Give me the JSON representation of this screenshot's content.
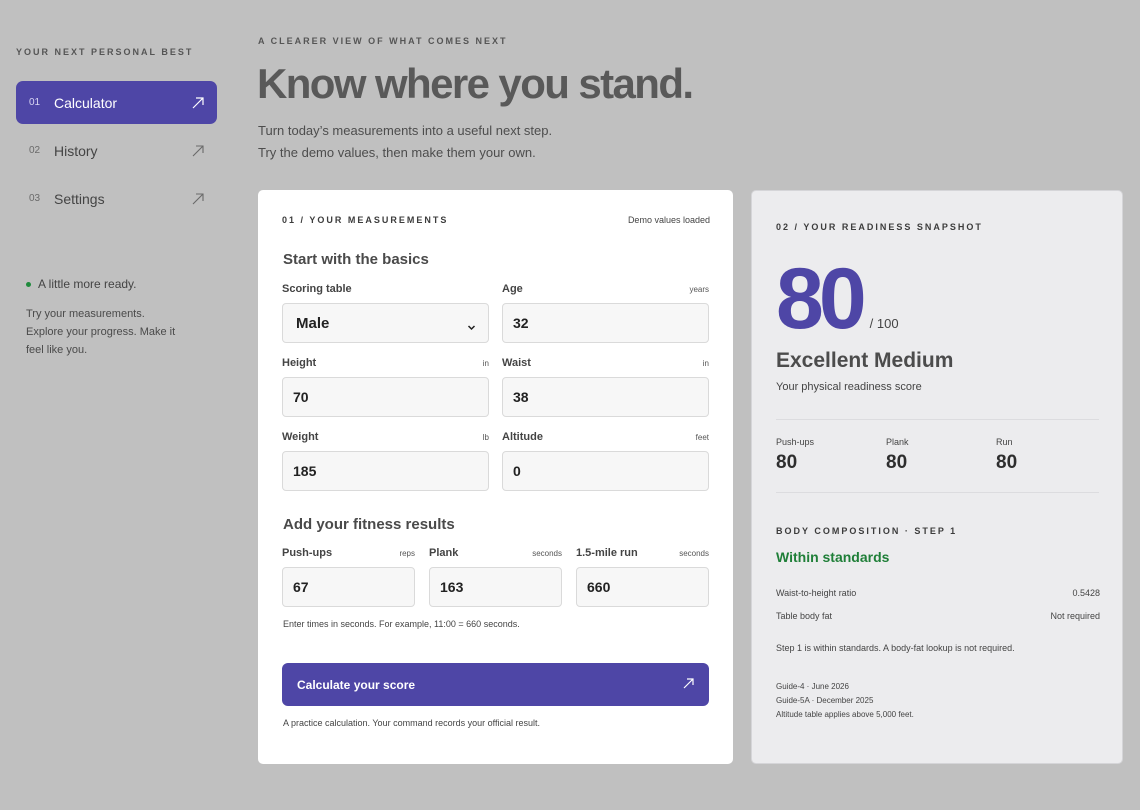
{
  "sidebar": {
    "brand": "YOUR NEXT PERSONAL BEST",
    "items": [
      {
        "num": "01",
        "label": "Calculator",
        "active": true
      },
      {
        "num": "02",
        "label": "History",
        "active": false
      },
      {
        "num": "03",
        "label": "Settings",
        "active": false
      }
    ],
    "status": {
      "line": "A little more ready.",
      "desc": "Try your measurements. Explore your progress. Make it feel like you."
    }
  },
  "header": {
    "eyebrow": "A CLEARER VIEW OF WHAT COMES NEXT",
    "title": "Know where you stand.",
    "intro_1": "Turn today’s measurements into a useful next step.",
    "intro_2": "Try the demo values, then make them your own."
  },
  "measurements": {
    "section_label": "01 / YOUR MEASUREMENTS",
    "demo_note": "Demo values loaded",
    "basics_title": "Start with the basics",
    "scoring_table": {
      "label": "Scoring table",
      "value": "Male"
    },
    "age": {
      "label": "Age",
      "unit": "years",
      "value": "32"
    },
    "height": {
      "label": "Height",
      "unit": "in",
      "value": "70"
    },
    "waist": {
      "label": "Waist",
      "unit": "in",
      "value": "38"
    },
    "weight": {
      "label": "Weight",
      "unit": "lb",
      "value": "185"
    },
    "altitude": {
      "label": "Altitude",
      "unit": "feet",
      "value": "0"
    },
    "fitness_title": "Add your fitness results",
    "pushups": {
      "label": "Push-ups",
      "unit": "reps",
      "value": "67"
    },
    "plank": {
      "label": "Plank",
      "unit": "seconds",
      "value": "163"
    },
    "run": {
      "label": "1.5-mile run",
      "unit": "seconds",
      "value": "660"
    },
    "hint": "Enter times in seconds. For example, 11:00 = 660 seconds.",
    "cta": "Calculate your score",
    "cta_note": "A practice calculation. Your command records your official result."
  },
  "snapshot": {
    "section_label": "02 / YOUR READINESS SNAPSHOT",
    "score": "80",
    "score_max": "/ 100",
    "rating": "Excellent Medium",
    "subtitle": "Your physical readiness score",
    "metrics": [
      {
        "label": "Push-ups",
        "value": "80"
      },
      {
        "label": "Plank",
        "value": "80"
      },
      {
        "label": "Run",
        "value": "80"
      }
    ],
    "body_comp": {
      "label": "BODY COMPOSITION · STEP 1",
      "status": "Within standards",
      "status_color": "#1f7f38",
      "rows": [
        {
          "key": "Waist-to-height ratio",
          "value": "0.5428"
        },
        {
          "key": "Table body fat",
          "value": "Not required"
        }
      ],
      "note": "Step 1 is within standards. A body-fat lookup is not required."
    },
    "references": [
      "Guide-4 · June 2026",
      "Guide-5A · December 2025",
      "Altitude table applies above 5,000 feet."
    ]
  },
  "colors": {
    "accent": "#4e46a6",
    "background": "#c0c0c0",
    "success": "#1f7f38"
  }
}
